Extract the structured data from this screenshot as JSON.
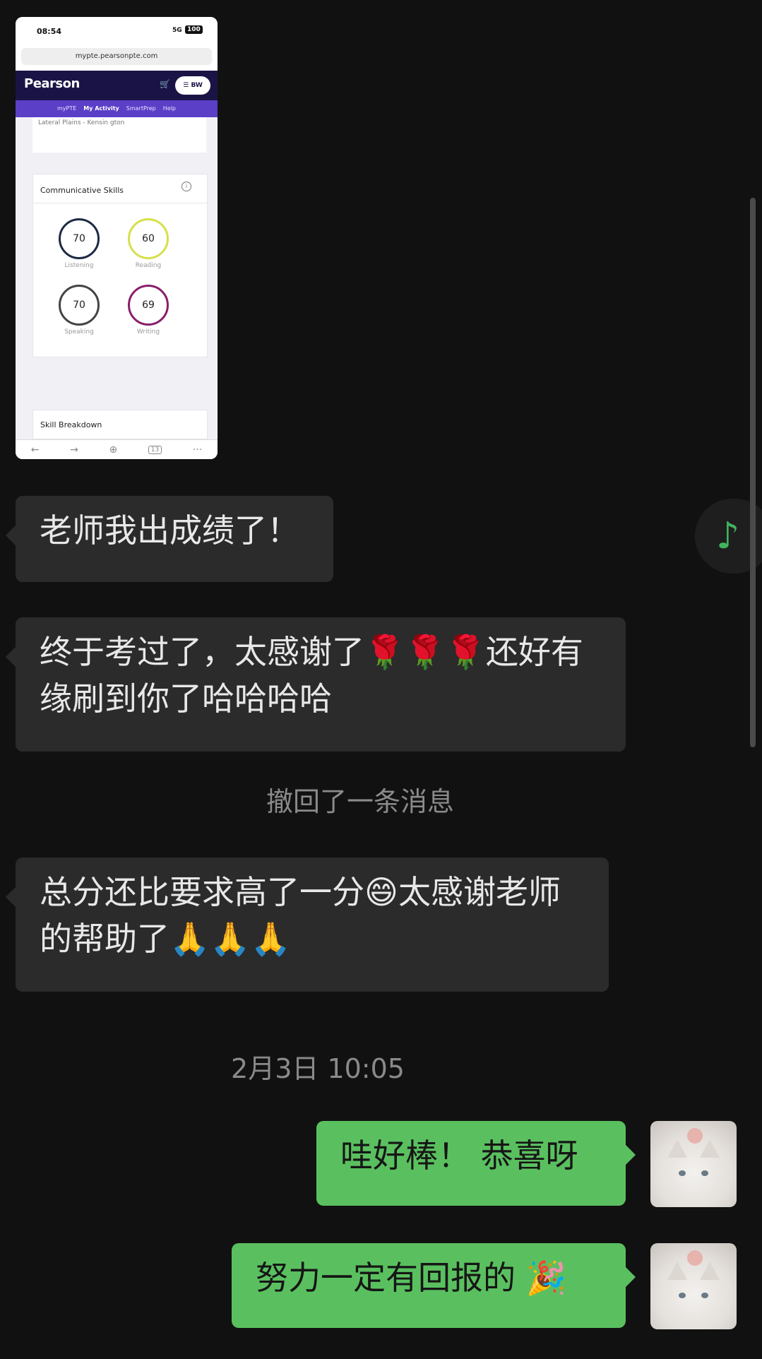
{
  "thumbnail": {
    "status_time": "08:54",
    "status_signal": "5G",
    "status_battery": "100",
    "url": "mypte.pearsonpte.com",
    "logo": "Pearson",
    "user_initials": "BW",
    "nav": [
      "myPTE",
      "My Activity",
      "SmartPrep",
      "Help"
    ],
    "fragment_text": "Lateral Plains - Kensin gton",
    "card_title": "Communicative Skills",
    "skills": [
      {
        "label": "Listening",
        "score": "70",
        "color": "#1d2a44"
      },
      {
        "label": "Reading",
        "score": "60",
        "color": "#d6e04a"
      },
      {
        "label": "Speaking",
        "score": "70",
        "color": "#444444"
      },
      {
        "label": "Writing",
        "score": "69",
        "color": "#8a1f6a"
      }
    ],
    "card2_title": "Skill Breakdown",
    "tabs_count": "13"
  },
  "messages": [
    {
      "side": "left",
      "text": "老师我出成绩了！"
    },
    {
      "side": "left",
      "text": "终于考过了，太感谢了🌹🌹🌹还好有缘刷到你了哈哈哈哈"
    },
    {
      "side": "system",
      "text": "撤回了一条消息"
    },
    {
      "side": "left",
      "text": "总分还比要求高了一分😄太感谢老师的帮助了🙏🙏🙏"
    },
    {
      "side": "timestamp",
      "text": "2月3日 10:05"
    },
    {
      "side": "right",
      "text": "哇好棒！ 恭喜呀"
    },
    {
      "side": "right",
      "text": "努力一定有回报的 🎉"
    }
  ],
  "colors": {
    "background": "#111111",
    "incoming": "#2b2b2b",
    "outgoing": "#5ac05f"
  },
  "icons": {
    "music": "music-note-icon"
  }
}
